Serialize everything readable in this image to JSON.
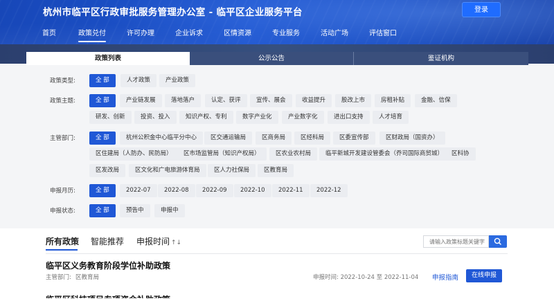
{
  "header": {
    "site_title": "杭州市临平区行政审批服务管理办公室 - 临平区企业服务平台",
    "login_label": "登录",
    "nav": [
      {
        "label": "首页"
      },
      {
        "label": "政策兑付",
        "active": true
      },
      {
        "label": "许可办理"
      },
      {
        "label": "企业诉求"
      },
      {
        "label": "区情资源"
      },
      {
        "label": "专业服务"
      },
      {
        "label": "活动广场"
      },
      {
        "label": "评估窗口"
      }
    ]
  },
  "tabs": [
    {
      "label": "政策列表",
      "active": true
    },
    {
      "label": "公示公告"
    },
    {
      "label": "鉴证机构"
    }
  ],
  "filters": {
    "policy_type": {
      "label": "政策类型:",
      "options": [
        "全 部",
        "人才政策",
        "产业政策"
      ]
    },
    "policy_theme": {
      "label": "政策主题:",
      "options_row1": [
        "全 部",
        "产业链发展",
        "落地落户",
        "认定、获评",
        "宣传、展会",
        "收益提升",
        "股改上市",
        "房租补贴",
        "金融、信保"
      ],
      "options_row2": [
        "研发、创新",
        "投资、投入",
        "知识产权、专利",
        "数字产业化",
        "产业数字化",
        "进出口支持",
        "人才培育"
      ]
    },
    "department": {
      "label": "主管部门:",
      "options_row1": [
        "全 部",
        "杭州公积金中心临平分中心",
        "区交通运输局",
        "区商务局",
        "区经科局",
        "区委宣传部",
        "区财政局（国资办）"
      ],
      "options_row2": [
        "区住建局（人防办、民防局）",
        "区市场监管局（知识产权局）",
        "区农业农村局",
        "临平新城开发建设管委会（乔司国际商贸城）",
        "区科协"
      ],
      "options_row3": [
        "区发改局",
        "区文化和广电旅游体育局",
        "区人力社保局",
        "区教育局"
      ]
    },
    "month": {
      "label": "申报月历:",
      "options": [
        "全 部",
        "2022-07",
        "2022-08",
        "2022-09",
        "2022-10",
        "2022-11",
        "2022-12"
      ]
    },
    "status": {
      "label": "申报状态:",
      "options": [
        "全 部",
        "预告中",
        "申报中"
      ]
    }
  },
  "sort_tabs": {
    "all": "所有政策",
    "smart": "智能推荐",
    "time": "申报时间",
    "time_arrows": "↑↓"
  },
  "search": {
    "placeholder": "请输入政策标题关键字"
  },
  "policies": [
    {
      "title": "临平区义务教育阶段学位补助政策",
      "department_label": "主管部门:",
      "department": "区教育局",
      "period": "申报时间:  2022-10-24 至 2022-11-04",
      "guide_label": "申报指南",
      "apply_label": "在线申报"
    },
    {
      "title": "临平区科技项目专项资金补助政策"
    }
  ],
  "colors": {
    "brand": "#2058d6",
    "header": "#1e56d1"
  }
}
